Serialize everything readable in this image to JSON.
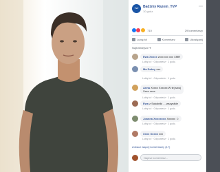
{
  "post": {
    "page_name": "Badźmy Razem_TVP",
    "time": "10 godz.",
    "page_logo_text": "TVP",
    "reaction_count": "710",
    "comment_count": "29 komentarzy",
    "actions": {
      "like": "Lubię to!",
      "comment": "Komentarz",
      "share": "Udostępnij"
    },
    "sort_label": "Najtrafniejsze ▾"
  },
  "comments": [
    {
      "author": "Ewa Xxxxx",
      "text": "zxxx xxx xxx XMR",
      "meta": "Lubię to! · Odpowiedz · 1 godz."
    },
    {
      "author": "Ma Dobry",
      "text": "xxx",
      "meta": "Lubię to! · Odpowiedz · 1 godz."
    },
    {
      "author": "Anna",
      "text": "Xxxxx Xxxxxx W tej swoj",
      "text2": "Xxxx xxxx",
      "meta": "Lubię to! · Odpowiedz · 1 godz."
    },
    {
      "author": "Ewa",
      "text": "z Sokolniki ... wszystkie",
      "meta": "Lubię to! · Odpowiedz · 1 godz."
    },
    {
      "author": "Joanna Xxxxxxxx",
      "text": "Xxxxxx ☺",
      "meta": "Lubię to! · Odpowiedz · 1 godz."
    },
    {
      "author": "Xxxx Xxxxx",
      "text": "xxx",
      "meta": "Lubię to! · Odpowiedz · 1 godz."
    }
  ],
  "more_comments": "Zobacz więcej komentarzy (17)",
  "composer": {
    "placeholder": "Napisz komentarz..."
  }
}
